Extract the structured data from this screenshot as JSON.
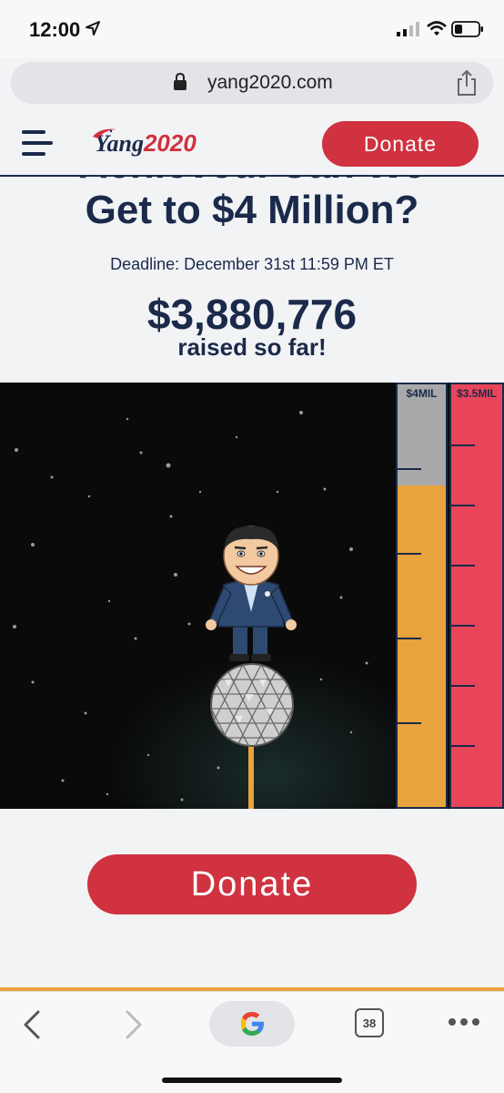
{
  "status_bar": {
    "time": "12:00"
  },
  "browser": {
    "url": "yang2020.com",
    "tab_count": "38"
  },
  "header": {
    "logo_main": "Yang",
    "logo_year": "2020",
    "donate_label": "Donate"
  },
  "hero": {
    "headline_hidden": "Achieved. Can We",
    "headline": "Get to $4 Million?",
    "deadline": "Deadline: December 31st 11:59 PM ET",
    "amount": "$3,880,776",
    "raised_label": "raised so far!"
  },
  "meter": {
    "orange_label": "$4MIL",
    "red_label": "$3.5MIL",
    "orange_fill_fraction": 0.76,
    "colors": {
      "orange": "#e8a33c",
      "red": "#e8455a",
      "gray": "#a9a9ab",
      "navy": "#1b2a4a"
    }
  },
  "cta": {
    "donate_label": "Donate"
  },
  "icons": [
    "location-arrow-icon",
    "signal-icon",
    "wifi-icon",
    "battery-icon",
    "lock-icon",
    "share-icon",
    "hamburger-menu-icon",
    "back-icon",
    "forward-icon",
    "google-icon",
    "tabs-icon",
    "more-icon"
  ]
}
